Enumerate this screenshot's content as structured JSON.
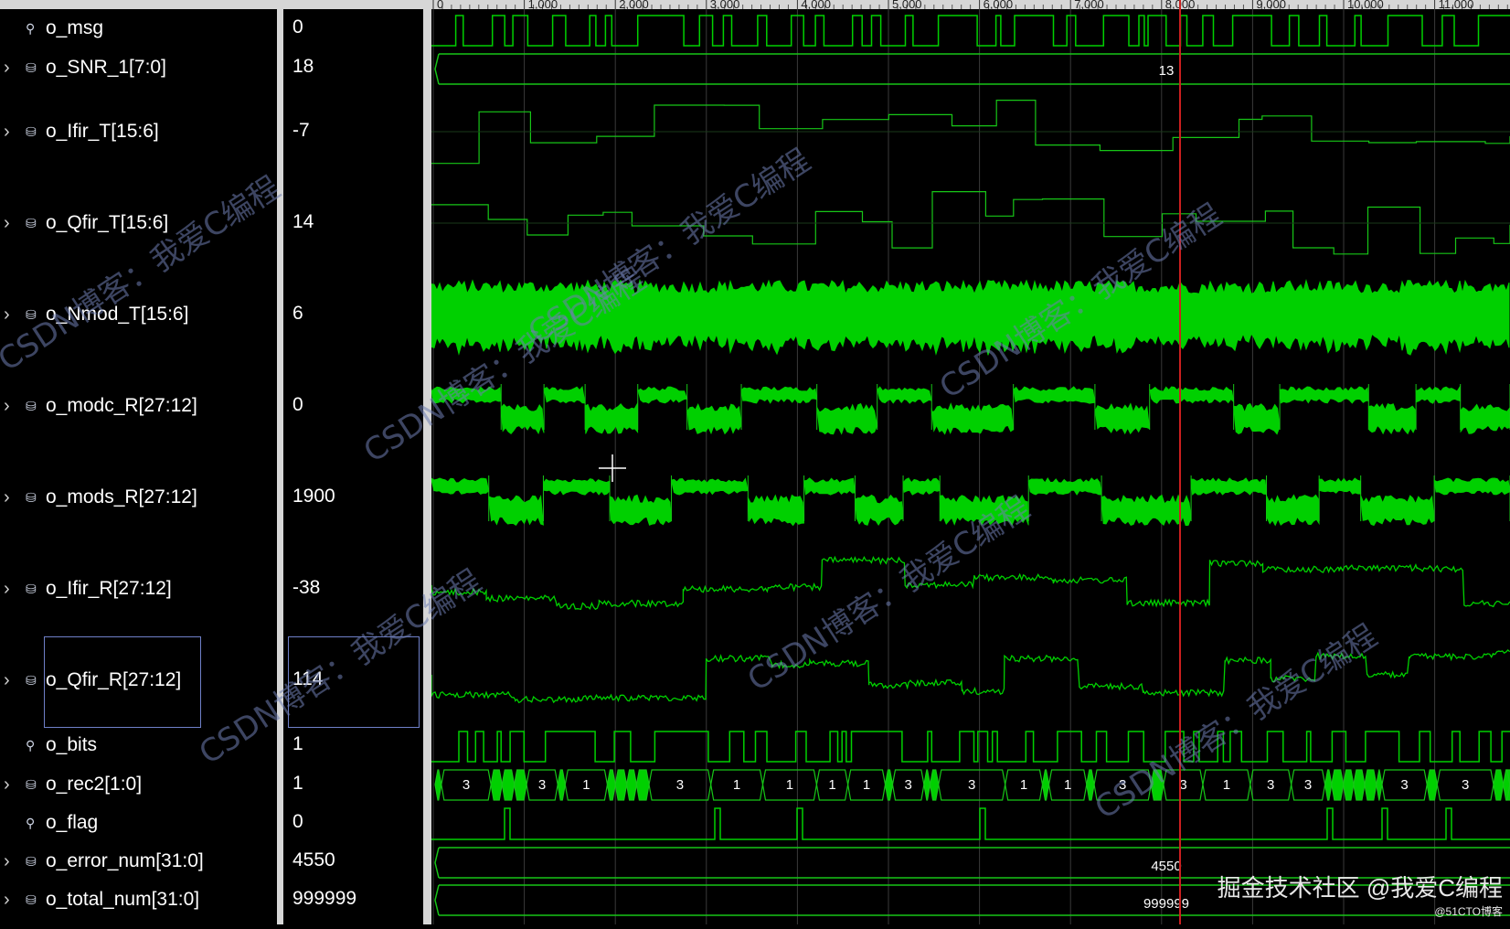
{
  "signals": [
    {
      "name": "o_msg",
      "value": "0",
      "kind": "bit"
    },
    {
      "name": "o_SNR_1[7:0]",
      "value": "18",
      "kind": "bus"
    },
    {
      "name": "o_Ifir_T[15:6]",
      "value": "-7",
      "kind": "bus"
    },
    {
      "name": "o_Qfir_T[15:6]",
      "value": "14",
      "kind": "bus"
    },
    {
      "name": "o_Nmod_T[15:6]",
      "value": "6",
      "kind": "bus"
    },
    {
      "name": "o_modc_R[27:12]",
      "value": "0",
      "kind": "bus"
    },
    {
      "name": "o_mods_R[27:12]",
      "value": "1900",
      "kind": "bus"
    },
    {
      "name": "o_Ifir_R[27:12]",
      "value": "-38",
      "kind": "bus"
    },
    {
      "name": "o_Qfir_R[27:12]",
      "value": "114",
      "kind": "bus"
    },
    {
      "name": "o_bits",
      "value": "1",
      "kind": "bit"
    },
    {
      "name": "o_rec2[1:0]",
      "value": "1",
      "kind": "bus"
    },
    {
      "name": "o_flag",
      "value": "0",
      "kind": "bit"
    },
    {
      "name": "o_error_num[31:0]",
      "value": "4550",
      "kind": "bus"
    },
    {
      "name": "o_total_num[31:0]",
      "value": "999999",
      "kind": "bus"
    }
  ],
  "ruler": {
    "labels": [
      "0",
      "1,000",
      "2,000",
      "3,000",
      "4,000",
      "5,000",
      "6,000",
      "7,000",
      "8,000",
      "9,000",
      "10,000",
      "11,000"
    ]
  },
  "bus_labels": {
    "snr": "13",
    "error_num": "4550",
    "total_num": "999999",
    "rec2_values": [
      "3",
      "3",
      "1",
      "3",
      "1",
      "1",
      "1",
      "1",
      "3",
      "3",
      "1",
      "1",
      "3",
      "3",
      "1",
      "3",
      "3",
      "3",
      "3",
      "3",
      "1"
    ]
  },
  "cursor": {
    "color": "#cc1f1f"
  },
  "colors": {
    "wave": "#00d000",
    "trace": "#17c617",
    "grid": "#3a3a3a",
    "background": "#000000"
  },
  "watermarks": [
    "CSDN博客：我爱C编程",
    "CSDN博客：我爱C编程",
    "CSDN博客：我爱C编程",
    "CSDN博客：我爱C编程",
    "CSDN博客：我爱C编程",
    "CSDN博客：我爱C编程",
    "CSDN博客：我爱C编程"
  ],
  "footer": {
    "line1": "掘金技术社区 @我爱C编程",
    "line2": "@51CTO博客"
  }
}
